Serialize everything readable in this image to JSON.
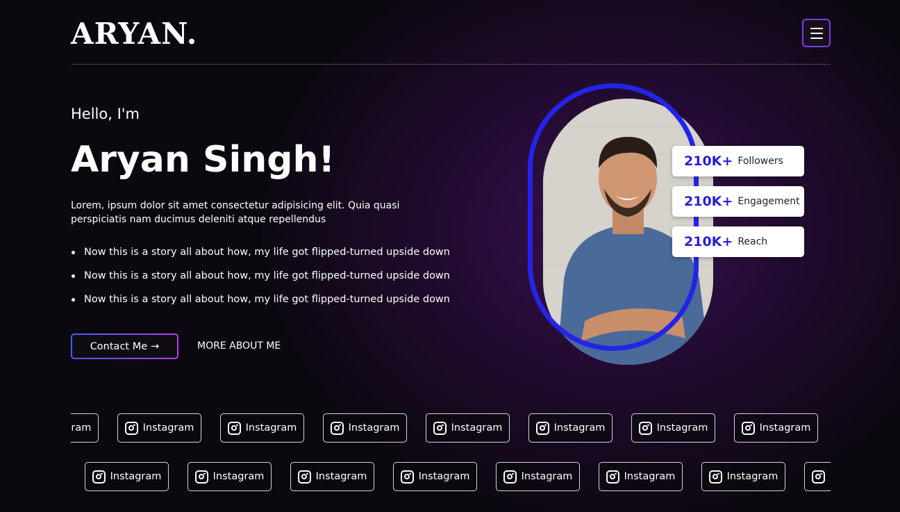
{
  "brand": {
    "logo": "ARYAN."
  },
  "header": {
    "menu_icon": "hamburger-menu-icon"
  },
  "hero": {
    "greeting": "Hello, I'm",
    "name": "Aryan Singh!",
    "intro": "Lorem, ipsum dolor sit amet consectetur adipisicing elit. Quia quasi perspiciatis nam ducimus deleniti atque repellendus",
    "bullets": [
      "Now this is a story all about how, my life got flipped-turned upside down",
      "Now this is a story all about how, my life got flipped-turned upside down",
      "Now this is a story all about how, my life got flipped-turned upside down"
    ],
    "contact_label": "Contact Me",
    "contact_arrow": "→",
    "more_label": "MORE ABOUT ME"
  },
  "stats": [
    {
      "value": "210K+",
      "label": "Followers"
    },
    {
      "value": "210K+",
      "label": "Engagement"
    },
    {
      "value": "210K+",
      "label": "Reach"
    }
  ],
  "social_ticker": {
    "label": "Instagram",
    "icon": "instagram-icon"
  },
  "colors": {
    "accent_blue": "#2424e8",
    "stat_number": "#2a1fd6",
    "button_gradient_start": "#4a5cff",
    "button_gradient_end": "#b43cf0",
    "background": "#0b0a0e"
  }
}
